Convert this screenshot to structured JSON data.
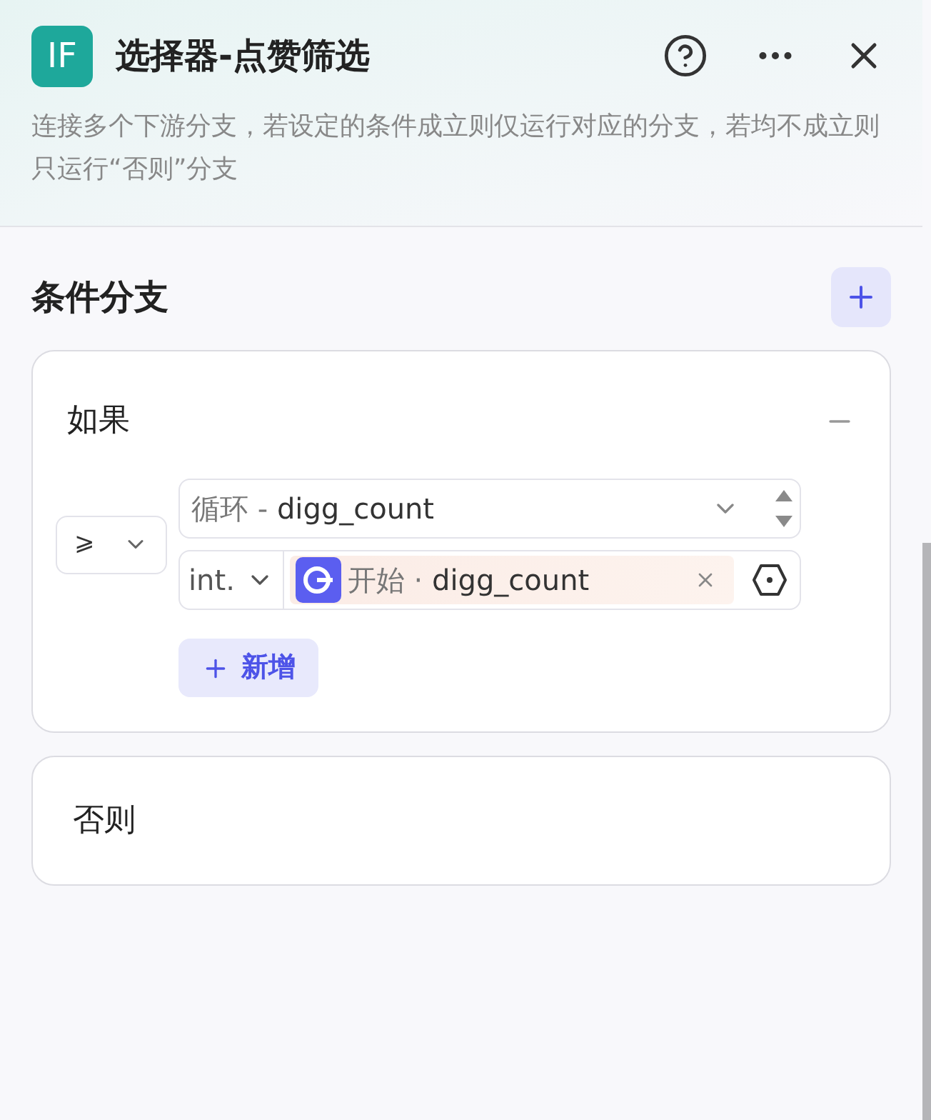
{
  "header": {
    "logo": "IF",
    "title": "选择器-点赞筛选",
    "description": "连接多个下游分支，若设定的条件成立则仅运行对应的分支，若均不成立则只运行“否则”分支"
  },
  "section": {
    "title": "条件分支"
  },
  "branches": [
    {
      "kind": "if",
      "label": "如果",
      "expanded": true,
      "conditions": [
        {
          "operator": "⩾",
          "left": {
            "source": "循环",
            "separator": "-",
            "variable": "digg_count"
          },
          "type": "int.",
          "right": {
            "source": "开始",
            "separator": "·",
            "variable": "digg_count"
          }
        }
      ],
      "add_label": "新增"
    },
    {
      "kind": "else",
      "label": "否则"
    }
  ]
}
